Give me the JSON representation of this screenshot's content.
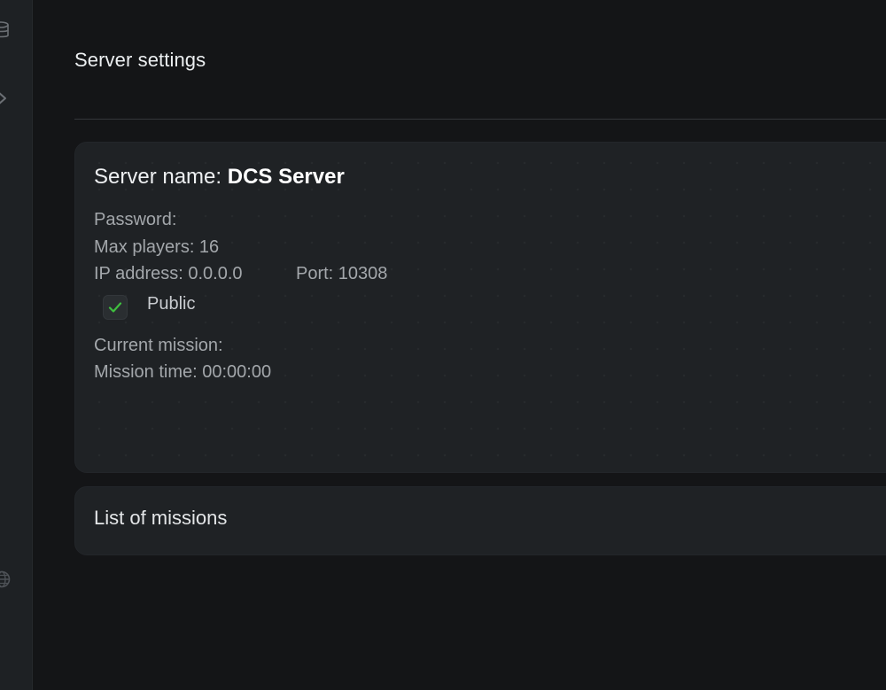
{
  "page": {
    "title": "Server settings"
  },
  "sidebar": {
    "icons": [
      "database-icon",
      "chevron-right-icon",
      "globe-icon"
    ]
  },
  "server": {
    "name_label": "Server name:",
    "name_value": "DCS Server",
    "password": "Password:",
    "max_players": "Max players: 16",
    "ip_address": "IP address: 0.0.0.0",
    "port": "Port: 10308",
    "public_label": "Public",
    "public_checked": true,
    "current_mission": "Current mission:",
    "mission_time": "Mission time: 00:00:00"
  },
  "missions": {
    "title": "List of missions"
  },
  "colors": {
    "background": "#141517",
    "card": "#1f2225",
    "check_accent": "#3fbf3f"
  }
}
